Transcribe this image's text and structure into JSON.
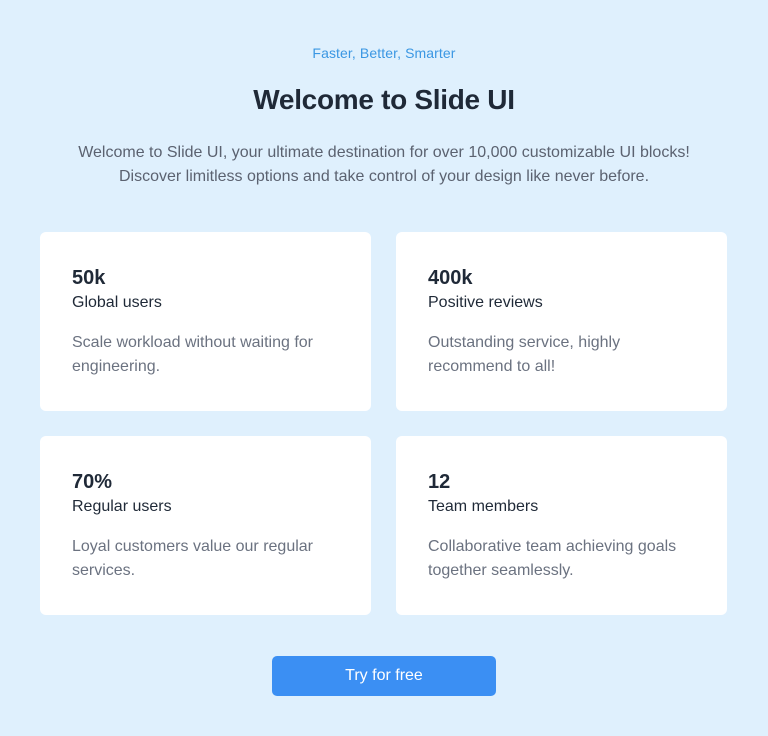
{
  "header": {
    "tagline": "Faster, Better, Smarter",
    "title": "Welcome to Slide UI",
    "intro": "Welcome to Slide UI, your ultimate destination for over 10,000 customizable UI blocks! Discover limitless options and take control of your design like never before."
  },
  "stats": [
    {
      "value": "50k",
      "label": "Global users",
      "description": "Scale workload without waiting for engineering."
    },
    {
      "value": "400k",
      "label": "Positive reviews",
      "description": "Outstanding service, highly recommend to all!"
    },
    {
      "value": "70%",
      "label": "Regular users",
      "description": "Loyal customers value our regular services."
    },
    {
      "value": "12",
      "label": "Team members",
      "description": "Collaborative team achieving goals together seamlessly."
    }
  ],
  "cta": {
    "label": "Try for free"
  },
  "colors": {
    "background": "#dff0fd",
    "accent": "#3b8ff3",
    "tagline": "#3b97e3",
    "heading": "#1f2937",
    "muted": "#6b7280"
  }
}
